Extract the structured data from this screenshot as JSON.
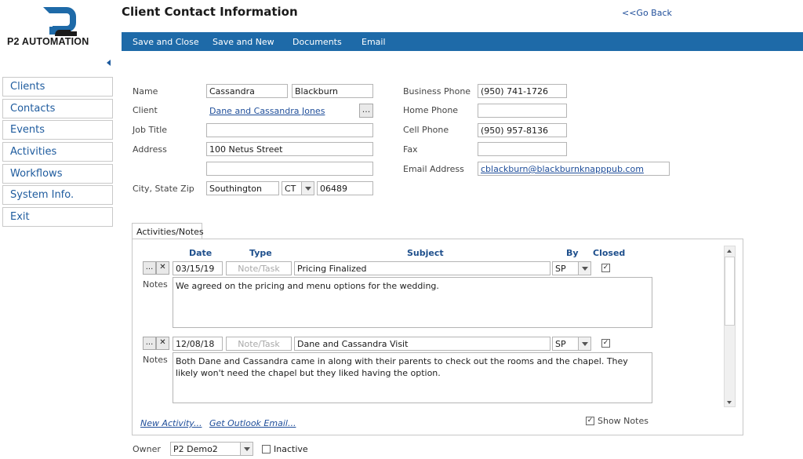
{
  "brand": {
    "name": "P2 AUTOMATION",
    "primary_color": "#1e6aa8"
  },
  "header": {
    "title": "Client Contact Information",
    "go_back": "<<Go Back"
  },
  "toolbar": {
    "save_close": "Save and Close",
    "save_new": "Save and New",
    "documents": "Documents",
    "email": "Email"
  },
  "sidebar": {
    "items": [
      {
        "label": "Clients"
      },
      {
        "label": "Contacts"
      },
      {
        "label": "Events"
      },
      {
        "label": "Activities"
      },
      {
        "label": "Workflows"
      },
      {
        "label": "System Info."
      },
      {
        "label": "Exit"
      }
    ]
  },
  "form": {
    "name_label": "Name",
    "first_name": "Cassandra",
    "last_name": "Blackburn",
    "client_label": "Client",
    "client_value": "Dane and Cassandra Jones",
    "job_title_label": "Job Title",
    "job_title": "",
    "address_label": "Address",
    "address1": "100 Netus Street",
    "address2": "",
    "city_state_zip_label": "City, State Zip",
    "city": "Southington",
    "state": "CT",
    "zip": "06489",
    "business_phone_label": "Business Phone",
    "business_phone": "(950) 741-1726",
    "home_phone_label": "Home Phone",
    "home_phone": "",
    "cell_phone_label": "Cell Phone",
    "cell_phone": "(950) 957-8136",
    "fax_label": "Fax",
    "fax": "",
    "email_label": "Email Address",
    "email": "cblackburn@blackburnknapppub.com",
    "ellipsis": "..."
  },
  "activities": {
    "tab_label": "Activities/Notes",
    "columns": {
      "date": "Date",
      "type": "Type",
      "subject": "Subject",
      "by": "By",
      "closed": "Closed"
    },
    "notes_label": "Notes",
    "rows": [
      {
        "date": "03/15/19",
        "type": "Note/Task",
        "subject": "Pricing Finalized",
        "by": "SP",
        "closed": "✓",
        "notes": "We agreed on the pricing and menu options for the wedding."
      },
      {
        "date": "12/08/18",
        "type": "Note/Task",
        "subject": "Dane and Cassandra Visit",
        "by": "SP",
        "closed": "✓",
        "notes": "Both Dane and Cassandra came in along with their parents to check out the rooms and the chapel.  They likely won't need the chapel but they liked having the option."
      }
    ],
    "new_activity": "New Activity...",
    "get_outlook_email": "Get Outlook Email...",
    "show_notes_label": "Show Notes",
    "show_notes_check": "✓",
    "row_edit_btn": "...",
    "row_delete_btn": "✕"
  },
  "footer": {
    "owner_label": "Owner",
    "owner_value": "P2 Demo2",
    "inactive_label": "Inactive",
    "inactive_check": ""
  }
}
